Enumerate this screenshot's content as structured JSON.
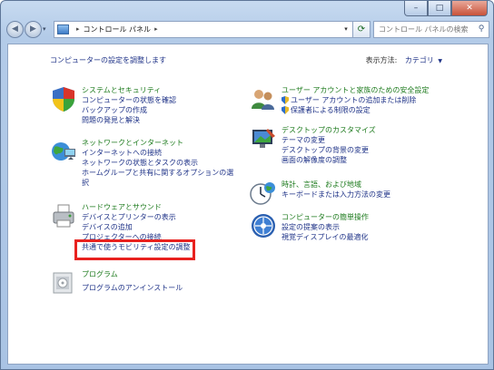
{
  "addressbar": {
    "crumb": "コントロール パネル"
  },
  "search": {
    "placeholder": "コントロール パネルの検索"
  },
  "header": {
    "title": "コンピューターの設定を調整します",
    "view_by_label": "表示方法:",
    "view_by_value": "カテゴリ"
  },
  "left_categories": [
    {
      "title": "システムとセキュリティ",
      "links": [
        "コンピューターの状態を確認",
        "バックアップの作成",
        "問題の発見と解決"
      ]
    },
    {
      "title": "ネットワークとインターネット",
      "links": [
        "インターネットへの接続",
        "ネットワークの状態とタスクの表示",
        "ホームグループと共有に関するオプションの選択"
      ]
    },
    {
      "title": "ハードウェアとサウンド",
      "links": [
        "デバイスとプリンターの表示",
        "デバイスの追加",
        "プロジェクターへの接続",
        "共通で使うモビリティ設定の調整"
      ]
    },
    {
      "title": "プログラム",
      "links": [
        "プログラムのアンインストール"
      ]
    }
  ],
  "right_categories": [
    {
      "title": "ユーザー アカウントと家族のための安全設定",
      "links": [
        "ユーザー アカウントの追加または削除",
        "保護者による制限の設定"
      ]
    },
    {
      "title": "デスクトップのカスタマイズ",
      "links": [
        "テーマの変更",
        "デスクトップの背景の変更",
        "画面の解像度の調整"
      ]
    },
    {
      "title": "時計、言語、および地域",
      "links": [
        "キーボードまたは入力方法の変更"
      ]
    },
    {
      "title": "コンピューターの簡単操作",
      "links": [
        "設定の提案の表示",
        "視覚ディスプレイの最適化"
      ]
    }
  ]
}
